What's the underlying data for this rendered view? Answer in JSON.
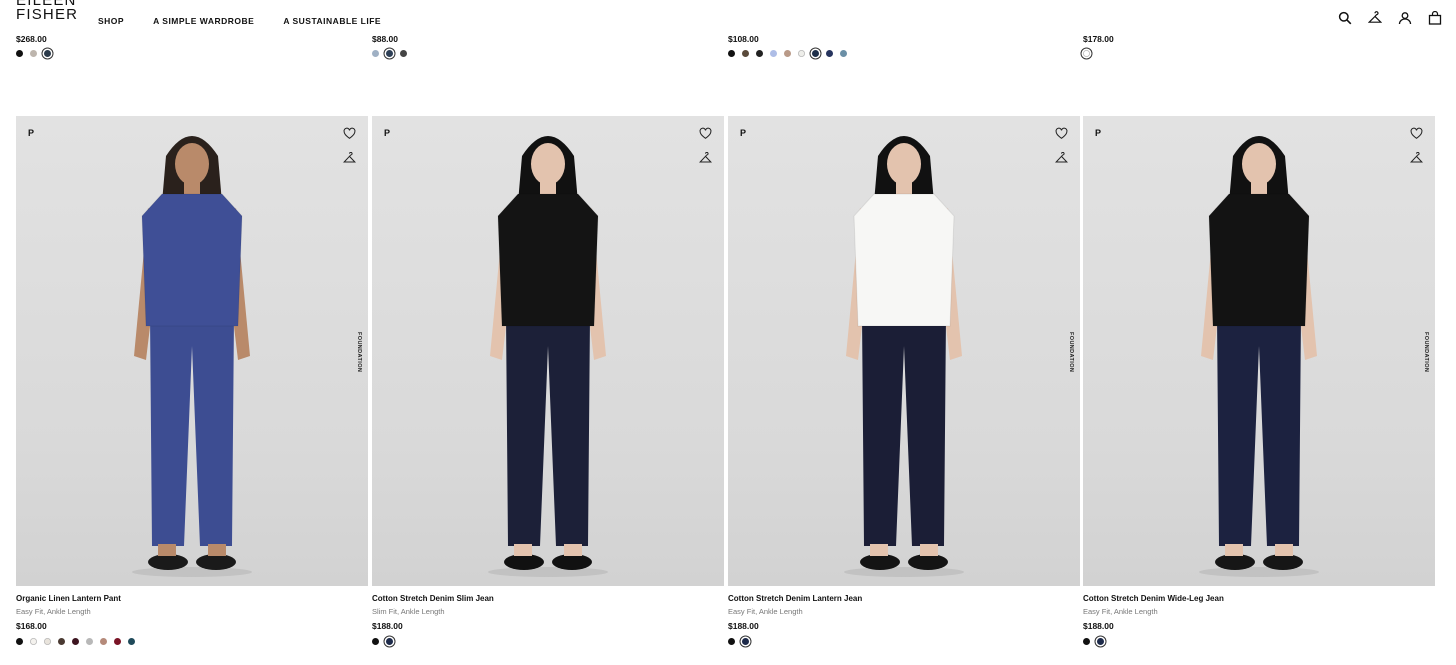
{
  "brand": {
    "line1": "EILEEN",
    "line2": "FISHER"
  },
  "nav": [
    "SHOP",
    "A SIMPLE WARDROBE",
    "A SUSTAINABLE LIFE"
  ],
  "utility_icons": [
    "search-icon",
    "hanger-icon",
    "account-icon",
    "bag-icon"
  ],
  "top_row": [
    {
      "price": "$268.00",
      "swatches": [
        "#111111",
        "#bdb5ad",
        "#2b3a4a"
      ],
      "selected": 2
    },
    {
      "price": "$88.00",
      "swatches": [
        "#9fb0c4",
        "#2d3f56",
        "#444444"
      ],
      "selected": 1
    },
    {
      "price": "$108.00",
      "swatches": [
        "#111111",
        "#5a4a3a",
        "#222222",
        "#aebde6",
        "#b99a88",
        "#eeeeea",
        "#1e2f4a",
        "#27345e",
        "#6b8fa6"
      ],
      "selected": 6
    },
    {
      "price": "$178.00",
      "swatches": [
        "#ffffff"
      ],
      "selected": 0
    }
  ],
  "products": [
    {
      "badge": "P",
      "side_label": "FOUNDATION",
      "name": "Organic Linen Lantern Pant",
      "fit": "Easy Fit, Ankle Length",
      "price": "$168.00",
      "swatches": [
        "#111111",
        "#f4f2ee",
        "#e9e4dc",
        "#4a3a32",
        "#3d1520",
        "#b8b8b8",
        "#b58a7a",
        "#7a1426",
        "#1f4a5a"
      ],
      "selected": -1,
      "top_color": "#3f4f96",
      "bottom_color": "#3d4d92",
      "shoe": "#1a1a1a",
      "skin": "#b98a6a",
      "hair": "#2a211c"
    },
    {
      "badge": "P",
      "side_label": "",
      "name": "Cotton Stretch Denim Slim Jean",
      "fit": "Slim Fit, Ankle Length",
      "price": "$188.00",
      "swatches": [
        "#111111",
        "#1d2a4a"
      ],
      "selected": 1,
      "top_color": "#141414",
      "bottom_color": "#1c2038",
      "shoe": "#111111",
      "skin": "#e3c3ae",
      "hair": "#111111"
    },
    {
      "badge": "P",
      "side_label": "FOUNDATION",
      "name": "Cotton Stretch Denim Lantern Jean",
      "fit": "Easy Fit, Ankle Length",
      "price": "$188.00",
      "swatches": [
        "#111111",
        "#1d2a4a"
      ],
      "selected": 1,
      "top_color": "#f7f7f5",
      "bottom_color": "#1b1e36",
      "shoe": "#141414",
      "skin": "#e3c3ae",
      "hair": "#111111"
    },
    {
      "badge": "P",
      "side_label": "FOUNDATION",
      "name": "Cotton Stretch Denim Wide-Leg Jean",
      "fit": "Easy Fit, Ankle Length",
      "price": "$188.00",
      "swatches": [
        "#111111",
        "#1d2a4a"
      ],
      "selected": 1,
      "top_color": "#131313",
      "bottom_color": "#1c2240",
      "shoe": "#161616",
      "skin": "#e3c3ae",
      "hair": "#111111"
    }
  ]
}
